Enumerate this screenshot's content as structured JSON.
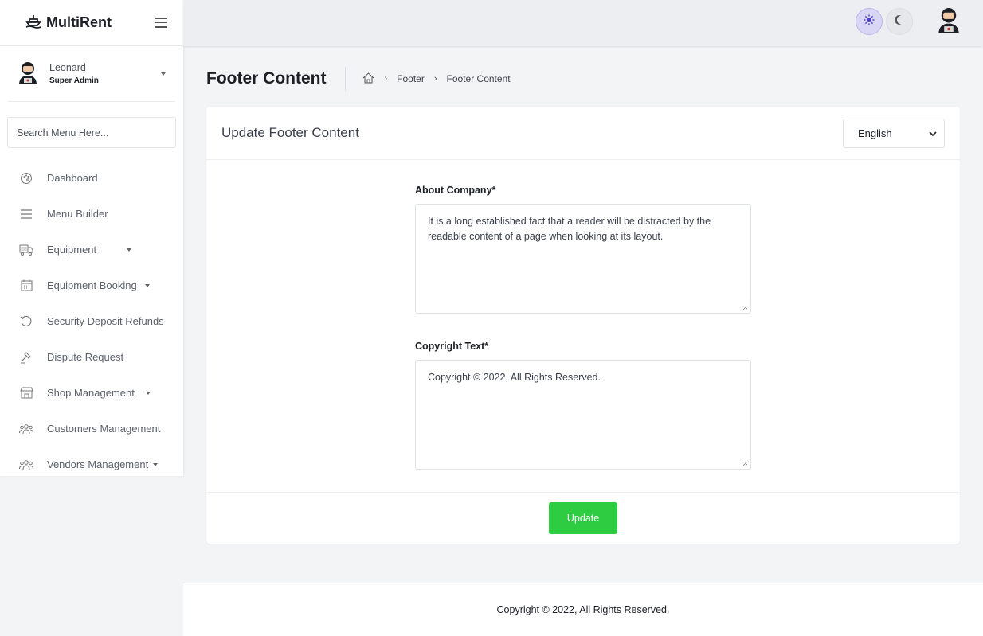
{
  "brand": {
    "name": "MultiRent",
    "logo_icon": "boat-icon",
    "menu_icon": "hamburger-icon"
  },
  "user": {
    "name": "Leonard",
    "role": "Super Admin"
  },
  "search": {
    "placeholder": "Search Menu Here..."
  },
  "sidebar": {
    "items": [
      {
        "label": "Dashboard",
        "icon": "palette-icon",
        "has_children": false
      },
      {
        "label": "Menu Builder",
        "icon": "bars-icon",
        "has_children": false
      },
      {
        "label": "Equipment",
        "icon": "truck-icon",
        "has_children": true
      },
      {
        "label": "Equipment Booking",
        "icon": "calendar-icon",
        "has_children": true
      },
      {
        "label": "Security Deposit Refunds",
        "icon": "undo-icon",
        "has_children": false
      },
      {
        "label": "Dispute Request",
        "icon": "gavel-icon",
        "has_children": false
      },
      {
        "label": "Shop Management",
        "icon": "shop-icon",
        "has_children": true
      },
      {
        "label": "Customers Management",
        "icon": "users-icon",
        "has_children": false
      },
      {
        "label": "Vendors Management",
        "icon": "users-icon",
        "has_children": true
      }
    ]
  },
  "topbar": {
    "light_icon": "sun-icon",
    "dark_icon": "moon-icon"
  },
  "page": {
    "title": "Footer Content",
    "breadcrumbs": [
      "Footer",
      "Footer Content"
    ]
  },
  "card": {
    "title": "Update Footer Content",
    "language": "English",
    "fields": {
      "about_label": "About Company*",
      "about_value": "It is a long established fact that a reader will be distracted by the readable content of a page when looking at its layout.",
      "copyright_label": "Copyright Text*",
      "copyright_value": "Copyright © 2022,  All Rights Reserved."
    },
    "submit_label": "Update"
  },
  "footer": {
    "text": "Copyright © 2022, All Rights Reserved."
  },
  "colors": {
    "accent": "#2ecc40",
    "primary": "#6c63e0"
  }
}
